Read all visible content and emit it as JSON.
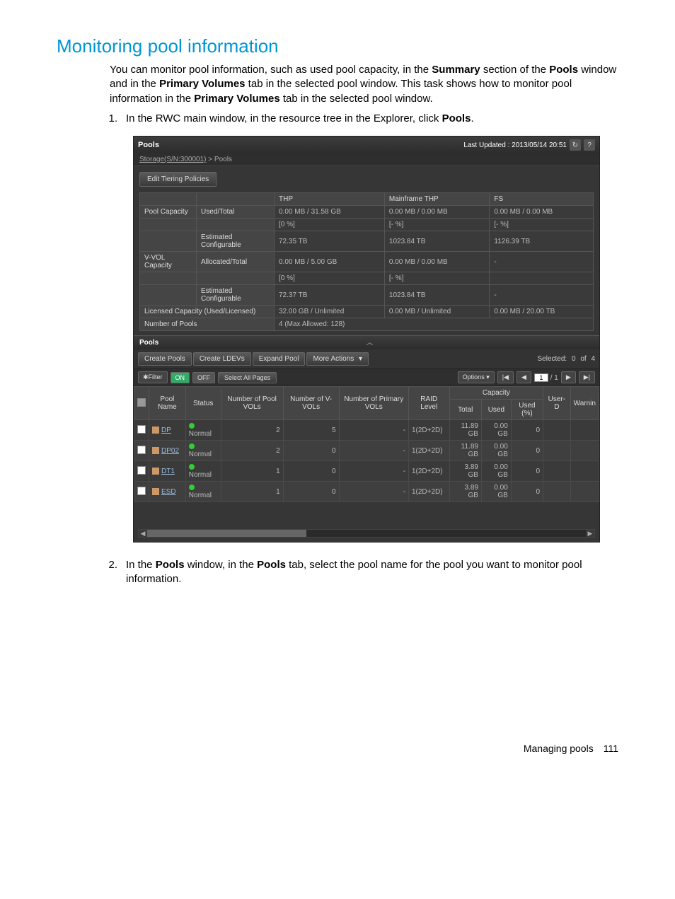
{
  "heading": "Monitoring pool information",
  "intro": {
    "p1a": "You can monitor pool information, such as used pool capacity, in the ",
    "p1b": "Summary",
    "p1c": " section of the ",
    "p1d": "Pools",
    "p1e": " window and in the ",
    "p1f": "Primary Volumes",
    "p1g": " tab in the selected pool window. This task shows how to monitor pool information in the ",
    "p1h": "Primary Volumes",
    "p1i": " tab in the selected pool window."
  },
  "steps": {
    "s1_num": "1.",
    "s1a": "In the RWC main window, in the resource tree in the Explorer, click ",
    "s1b": "Pools",
    "s1c": ".",
    "s2_num": "2.",
    "s2a": "In the ",
    "s2b": "Pools",
    "s2c": " window, in the ",
    "s2d": "Pools",
    "s2e": " tab, select the pool name for the pool you want to monitor pool information."
  },
  "shot": {
    "header_title": "Pools",
    "last_updated": "Last Updated : 2013/05/14 20:51",
    "refresh_icon": "↻",
    "help_icon": "?",
    "breadcrumb_link": "Storage(S/N:300001)",
    "breadcrumb_sep": " > ",
    "breadcrumb_curr": "Pools",
    "edit_tiering": "Edit Tiering Policies",
    "summary": {
      "cols": {
        "thp": "THP",
        "mainframe": "Mainframe THP",
        "fs": "FS"
      },
      "rows": [
        {
          "label": "Pool Capacity",
          "sub": "Used/Total",
          "thp": "0.00 MB / 31.58 GB",
          "mf": "0.00 MB / 0.00 MB",
          "fs": "0.00 MB / 0.00 MB"
        },
        {
          "label": "",
          "sub": "",
          "thp": "[0 %]",
          "mf": "[- %]",
          "fs": "[- %]"
        },
        {
          "label": "",
          "sub": "Estimated Configurable",
          "thp": "72.35 TB",
          "mf": "1023.84 TB",
          "fs": "1126.39 TB"
        },
        {
          "label": "V-VOL Capacity",
          "sub": "Allocated/Total",
          "thp": "0.00 MB / 5.00 GB",
          "mf": "0.00 MB / 0.00 MB",
          "fs": "-"
        },
        {
          "label": "",
          "sub": "",
          "thp": "[0 %]",
          "mf": "[- %]",
          "fs": ""
        },
        {
          "label": "",
          "sub": "Estimated Configurable",
          "thp": "72.37 TB",
          "mf": "1023.84 TB",
          "fs": "-"
        },
        {
          "label": "Licensed Capacity (Used/Licensed)",
          "sub": "",
          "thp": "32.00 GB / Unlimited",
          "mf": "0.00 MB / Unlimited",
          "fs": "0.00 MB / 20.00 TB"
        },
        {
          "label": "Number of Pools",
          "sub": "",
          "thp": "4 (Max Allowed: 128)",
          "mf": "",
          "fs": ""
        }
      ]
    },
    "sub_title": "Pools",
    "collapse_caret": "︿",
    "tb": {
      "create_pools": "Create Pools",
      "create_ldevs": "Create LDEVs",
      "expand_pool": "Expand Pool",
      "more_actions": "More Actions",
      "dropdown_caret": "▾",
      "selected_label": "Selected:",
      "selected_n": "0",
      "of_label": "of",
      "total_n": "4"
    },
    "tb2": {
      "filter_label": "✱Filter",
      "on": "ON",
      "off": "OFF",
      "select_all": "Select All Pages",
      "options": "Options ▾",
      "page_curr": "1",
      "page_sep": "/",
      "page_total": "1"
    },
    "table": {
      "headers": {
        "chk": "",
        "pool_name": "Pool Name",
        "status": "Status",
        "num_pool_vols": "Number of Pool VOLs",
        "num_vvols": "Number of V-VOLs",
        "num_primary": "Number of Primary VOLs",
        "raid_level": "RAID Level",
        "capacity": "Capacity",
        "total": "Total",
        "used": "Used",
        "used_pct": "Used (%)",
        "user_d": "User-D",
        "warnin": "Warnin"
      },
      "rows": [
        {
          "name": "DP",
          "status": "Normal",
          "npv": "2",
          "nvv": "5",
          "npr": "-",
          "raid": "1(2D+2D)",
          "total": "11.89 GB",
          "used": "0.00 GB",
          "upct": "0"
        },
        {
          "name": "DP02",
          "status": "Normal",
          "npv": "2",
          "nvv": "0",
          "npr": "-",
          "raid": "1(2D+2D)",
          "total": "11.89 GB",
          "used": "0.00 GB",
          "upct": "0"
        },
        {
          "name": "DT1",
          "status": "Normal",
          "npv": "1",
          "nvv": "0",
          "npr": "-",
          "raid": "1(2D+2D)",
          "total": "3.89 GB",
          "used": "0.00 GB",
          "upct": "0"
        },
        {
          "name": "ESD",
          "status": "Normal",
          "npv": "1",
          "nvv": "0",
          "npr": "-",
          "raid": "1(2D+2D)",
          "total": "3.89 GB",
          "used": "0.00 GB",
          "upct": "0"
        }
      ]
    },
    "scroll_left": "◀",
    "scroll_right": "▶"
  },
  "footer": {
    "section": "Managing pools",
    "page": "111"
  }
}
